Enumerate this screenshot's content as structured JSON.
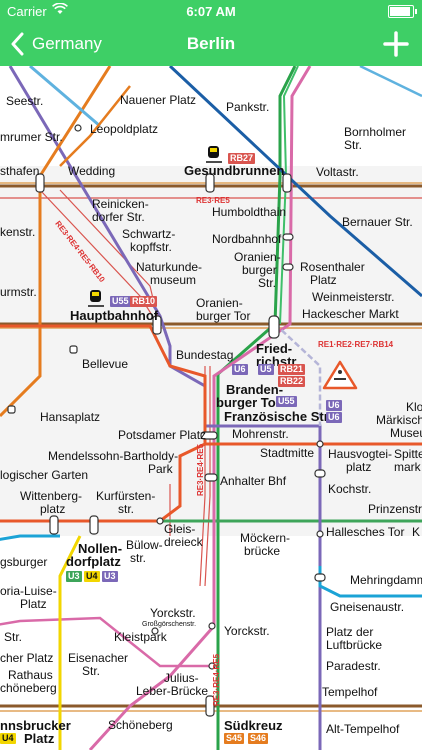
{
  "status_bar": {
    "carrier": "Carrier",
    "time": "6:07 AM",
    "battery_level": 0.9
  },
  "nav": {
    "back_label": "Germany",
    "title": "Berlin"
  },
  "map": {
    "stations": {
      "seestr": "Seestr.",
      "nauener_platz": "Nauener Platz",
      "pankstr": "Pankstr.",
      "bornholmer": "Bornholmer",
      "bornholmer_2": "Str.",
      "amrumer": "mrumer Str.",
      "leopoldplatz": "Leopoldplatz",
      "westhafen": "sthafen",
      "wedding": "Wedding",
      "gesundbrunnen": "Gesundbrunnen",
      "voltastr": "Voltastr.",
      "bernauer": "Bernauer Str.",
      "reinicken_1": "Reinicken-",
      "reinicken_2": "dorfer Str.",
      "humboldthain": "Humboldthain",
      "schwartz_1": "Schwartz-",
      "schwartz_2": "kopffstr.",
      "nordbahnhof": "Nordbahnhof",
      "rosenthaler_1": "Rosenthaler",
      "rosenthaler_2": "Platz",
      "birkenstr": "kenstr.",
      "naturkunde_1": "Naturkunde-",
      "naturkunde_2": "museum",
      "oranienburger_str_1": "Oranien-",
      "oranienburger_str_2": "burger",
      "oranienburger_str_3": "Str.",
      "weinmeister": "Weinmeisterstr.",
      "turmstr": "urmstr.",
      "hauptbahnhof": "Hauptbahnhof",
      "oranienburger_tor_1": "Oranien-",
      "oranienburger_tor_2": "burger Tor",
      "hackescher": "Hackescher Markt",
      "friedrich_1": "Fried-",
      "friedrich_2": "richstr.",
      "bundestag": "Bundestag",
      "bellevue": "Bellevue",
      "brandenburger_1": "Branden-",
      "brandenburger_2": "burger Tor",
      "franzoesische": "Französische Str.",
      "klo": "Klo",
      "maerkisch_1": "Märkisch",
      "maerkisch_2": "Museu",
      "hansaplatz": "Hansaplatz",
      "potsdamer": "Potsdamer Platz",
      "mohrenstr": "Mohrenstr.",
      "mendelssohn_1": "Mendelssohn-Bartholdy-",
      "mendelssohn_2": "Park",
      "stadtmitte": "Stadtmitte",
      "hausvogtei_1": "Hausvogtei-",
      "hausvogtei_2": "platz",
      "spittel_1": "Spitte",
      "spittel_2": "mark",
      "garten": "logischer Garten",
      "anhalter": "Anhalter Bhf",
      "kochstr": "Kochstr.",
      "wittenberg_1": "Wittenberg-",
      "wittenberg_2": "platz",
      "kurfuersten_1": "Kurfürsten-",
      "kurfuersten_2": "str.",
      "prinzenstr": "Prinzenstr.",
      "gleis_1": "Gleis-",
      "gleis_2": "dreieck",
      "hallesches": "Hallesches Tor",
      "koe": "K",
      "nollendorf_1": "Nollen-",
      "nollendorf_2": "dorfplatz",
      "buelow_1": "Bülow-",
      "buelow_2": "str.",
      "moeckern_1": "Möckern-",
      "moeckern_2": "brücke",
      "augsburger": "gsburger",
      "viktoria_1": "oria-Luise-",
      "viktoria_2": "Platz",
      "mehringdamm": "Mehringdamm",
      "gneisenau": "Gneisenaustr.",
      "yorckstr_s": "Yorckstr.",
      "grossgoersch": "Großgörschenstr.",
      "kleistpark": "Kleistpark",
      "str_left": "Str.",
      "yorckstr_u": "Yorckstr.",
      "luftbruecke_1": "Platz der",
      "luftbruecke_2": "Luftbrücke",
      "bayerischer": "cher Platz",
      "eisenacher_1": "Eisenacher",
      "eisenacher_2": "Str.",
      "rathaus_1": "Rathaus",
      "rathaus_2": "chöneberg",
      "julius_1": "Julius-",
      "julius_2": "Leber-Brücke",
      "paradestr": "Paradestr.",
      "tempelhof": "Tempelhof",
      "innsbrucker_1": "nnsbrucker",
      "innsbrucker_2": "Platz",
      "schoeneberg": "Schöneberg",
      "suedkreuz": "Südkreuz",
      "alt_tempelhof": "Alt-Tempelhof"
    },
    "badges": {
      "rb27": "RB27",
      "u55": "U55",
      "rb10": "RB10",
      "u6": "U6",
      "u5": "U5",
      "rb21": "RB21",
      "rb22": "RB22",
      "u55_b": "U55",
      "u6_a": "U6",
      "u6_b": "U6",
      "u3": "U3",
      "u4": "U4",
      "u3_b": "U3",
      "u4_b": "U4",
      "s45": "S45",
      "s46": "S46"
    },
    "route_labels": {
      "re3_re5": "RE3·RE5",
      "re_diag": "RE3·RE4·RE5·RB10",
      "re_east": "RE1·RE2·RE7·RB14",
      "re_vert": "RE3·RE4·RE5",
      "re_vert2": "RE3·RE4·RE5"
    },
    "colors": {
      "s_ring": "#8b5a2b",
      "u2": "#e8582a",
      "u6": "#7b68b8",
      "u8": "#1b5ea6",
      "u9": "#e57c1f",
      "u7": "#1ba3d6",
      "u1": "#3ea55a",
      "u4": "#f2d600",
      "s_green": "#2aa34a",
      "s_pink": "#d96aa8",
      "rail": "#d9554f"
    }
  }
}
